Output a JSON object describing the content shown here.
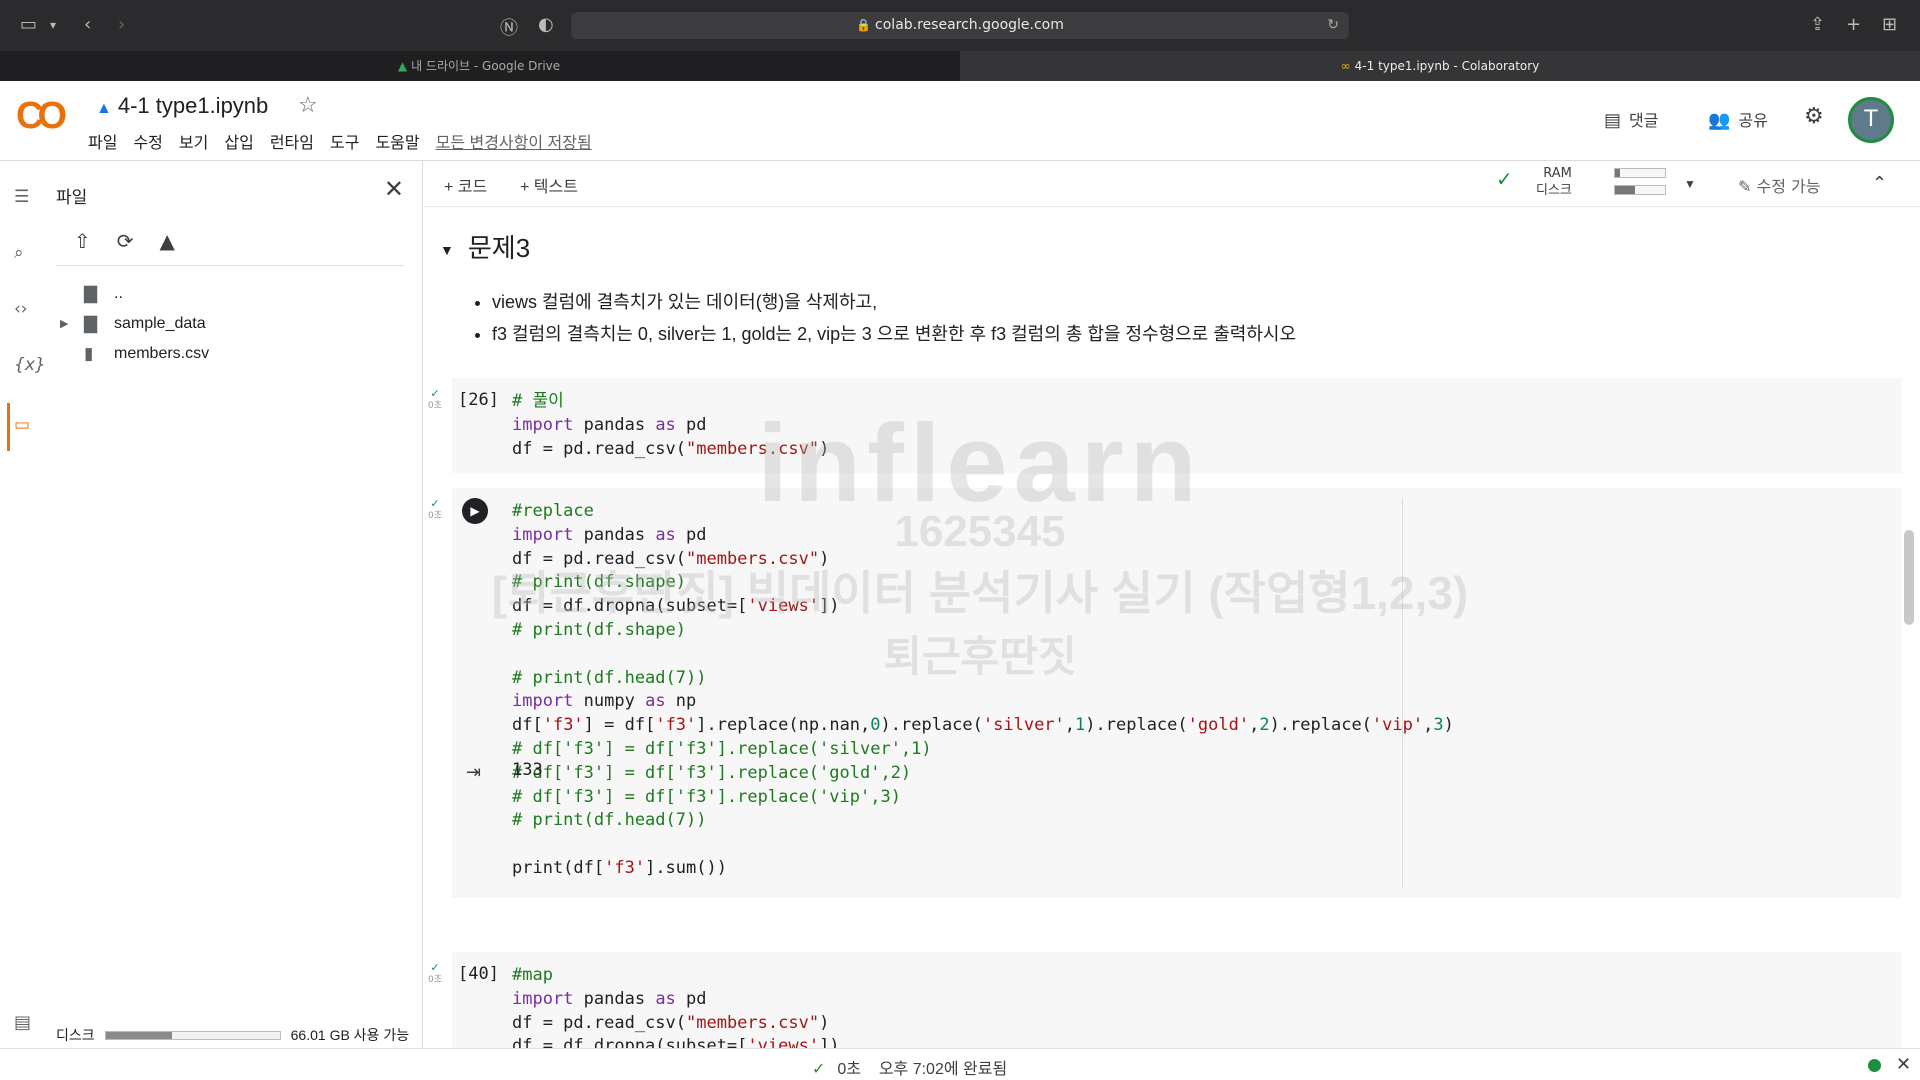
{
  "browser": {
    "url": "colab.research.google.com",
    "tabs": [
      {
        "label": "내 드라이브 - Google Drive",
        "active": false
      },
      {
        "label": "4-1 type1.ipynb - Colaboratory",
        "active": true
      }
    ]
  },
  "header": {
    "logo": "CO",
    "notebook_title": "4-1 type1.ipynb",
    "menu": [
      "파일",
      "수정",
      "보기",
      "삽입",
      "런타임",
      "도구",
      "도움말"
    ],
    "saved_status": "모든 변경사항이 저장됨",
    "comments_label": "댓글",
    "share_label": "공유",
    "avatar_initial": "T"
  },
  "sidebar": {
    "panel_title": "파일",
    "tree": [
      {
        "name": "..",
        "type": "parent"
      },
      {
        "name": "sample_data",
        "type": "folder"
      },
      {
        "name": "members.csv",
        "type": "file"
      }
    ],
    "disk_label": "디스크",
    "disk_available": "66.01 GB 사용 가능",
    "disk_used_fraction": 0.38
  },
  "toolbar": {
    "add_code": "+ 코드",
    "add_text": "+ 텍스트",
    "ram_label": "RAM",
    "disk_label": "디스크",
    "ram_fraction": 0.1,
    "disk_fraction": 0.4,
    "edit_label": "수정 가능"
  },
  "notebook": {
    "section_title": "문제3",
    "bullets": [
      "views 컬럼에 결측치가 있는 데이터(행)을 삭제하고,",
      "f3 컬럼의 결측치는 0, silver는 1, gold는 2, vip는 3 으로 변환한 후 f3 컬럼의 총 합을 정수형으로 출력하시오"
    ],
    "cells": [
      {
        "count": "[26]",
        "exec_time": "0초"
      },
      {
        "count": "",
        "exec_time": "0초",
        "output": "133"
      },
      {
        "count": "[40]",
        "exec_time": "0초"
      }
    ]
  },
  "watermark": {
    "brand": "inflearn",
    "id": "1625345",
    "course": "[퇴근후딴짓] 빅데이터 분석기사 실기 (작업형1,2,3)",
    "author": "퇴근후딴짓"
  },
  "status": {
    "duration": "0초",
    "completed": "오후 7:02에 완료됨"
  }
}
